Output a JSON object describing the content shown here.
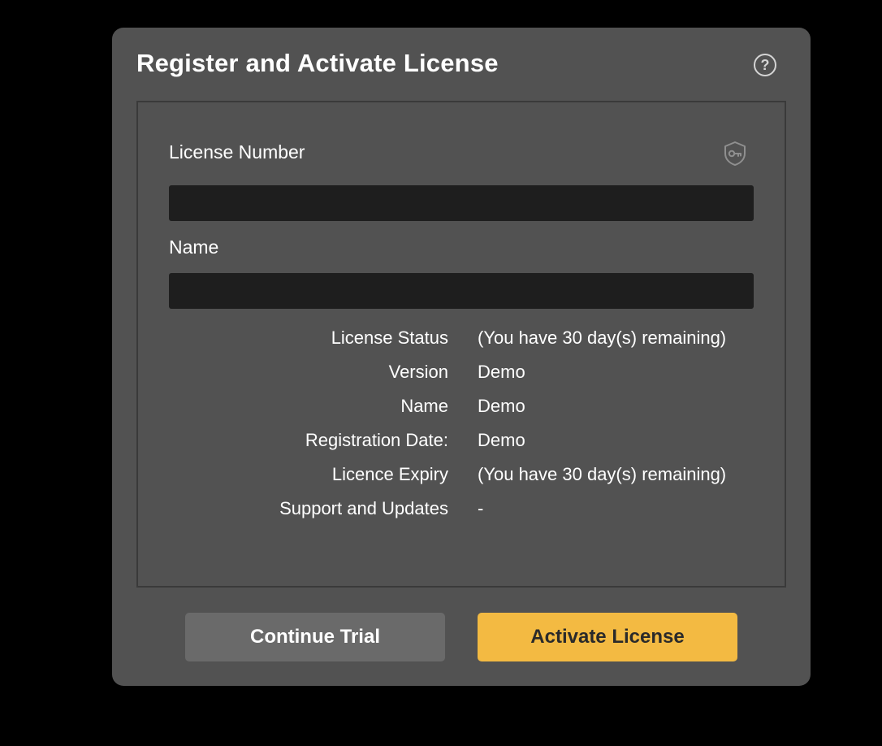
{
  "dialog": {
    "title": "Register and Activate License",
    "help_icon": "question-circle-icon",
    "help_glyph": "?"
  },
  "form": {
    "license_number_label": "License Number",
    "license_number_value": "",
    "license_icon": "shield-key-icon",
    "name_label": "Name",
    "name_value": ""
  },
  "info": [
    {
      "key": "License Status",
      "value": "(You have 30 day(s) remaining)"
    },
    {
      "key": "Version",
      "value": "Demo"
    },
    {
      "key": "Name",
      "value": "Demo"
    },
    {
      "key": "Registration Date:",
      "value": "Demo"
    },
    {
      "key": "Licence Expiry",
      "value": "(You have 30 day(s) remaining)"
    },
    {
      "key": "Support and Updates",
      "value": "-"
    }
  ],
  "buttons": {
    "continue_trial": "Continue Trial",
    "activate_license": "Activate License"
  },
  "colors": {
    "dialog_bg": "#525252",
    "input_bg": "#1e1e1e",
    "accent": "#f3ba42",
    "secondary_button": "#6a6a6a"
  }
}
